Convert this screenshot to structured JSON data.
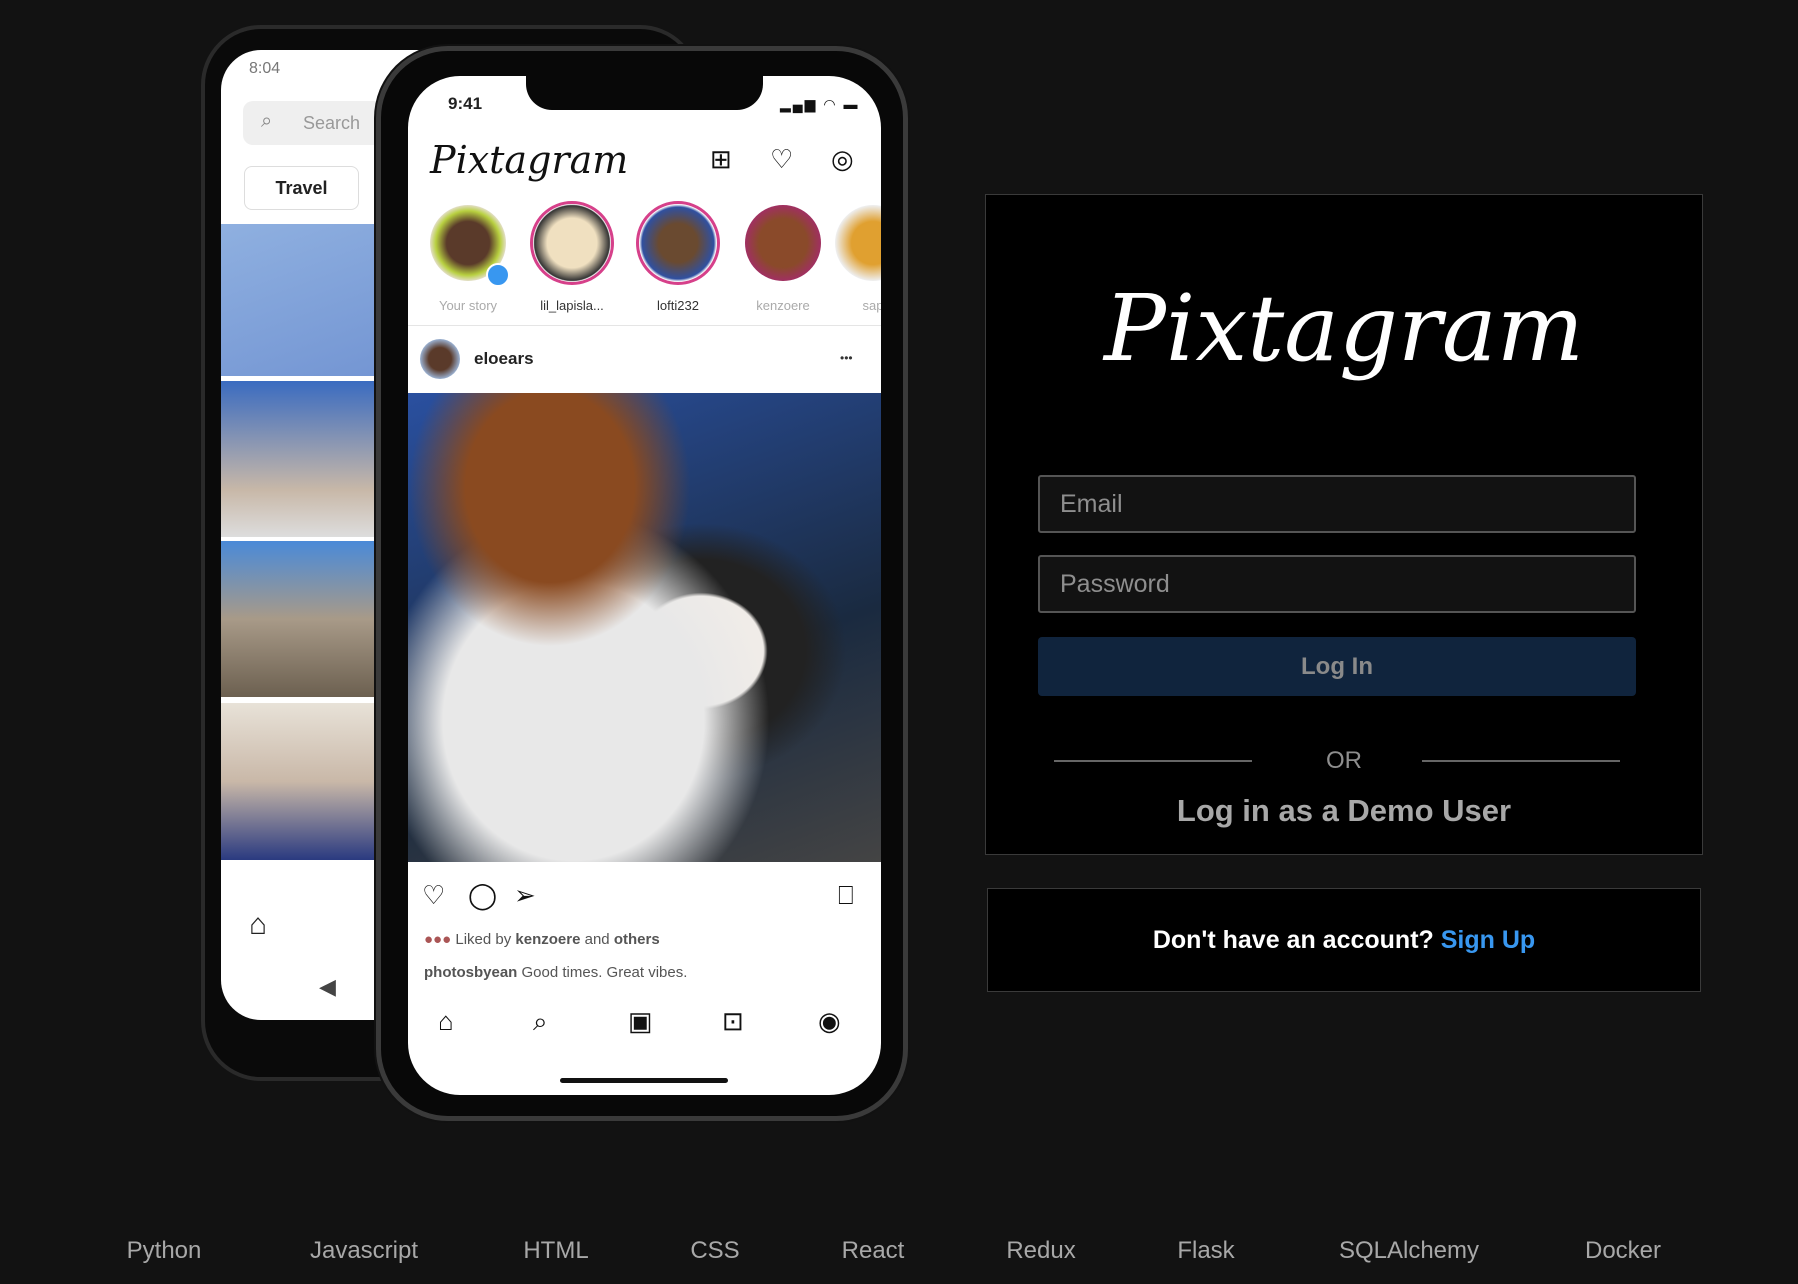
{
  "mockup": {
    "back_phone": {
      "time": "8:04",
      "search_placeholder": "Search",
      "chip": "Travel"
    },
    "front_phone": {
      "time": "9:41",
      "app_title": "Pixtagram",
      "stories": [
        "Your story",
        "lil_lapisla...",
        "lofti232",
        "kenzoere",
        "sap"
      ],
      "post_user": "eloears",
      "more": "•••",
      "liked_by_prefix": "Liked by ",
      "liked_by_user": "kenzoere",
      "liked_by_suffix": " and ",
      "liked_by_others": "others",
      "caption_user": "photosbyean",
      "caption_text": " Good times. Great vibes."
    }
  },
  "login": {
    "logo": "Pixtagram",
    "email_placeholder": "Email",
    "password_placeholder": "Password",
    "login_button": "Log In",
    "divider": "OR",
    "demo_login": "Log in as a Demo User"
  },
  "signup": {
    "prompt": "Don't have an account? ",
    "link": "Sign Up"
  },
  "footer": {
    "technologies": [
      "Python",
      "Javascript",
      "HTML",
      "CSS",
      "React",
      "Redux",
      "Flask",
      "SQLAlchemy",
      "Docker"
    ]
  },
  "colors": {
    "background": "#121212",
    "card": "#000000",
    "login_button": "#10243d",
    "link": "#3897f0"
  }
}
